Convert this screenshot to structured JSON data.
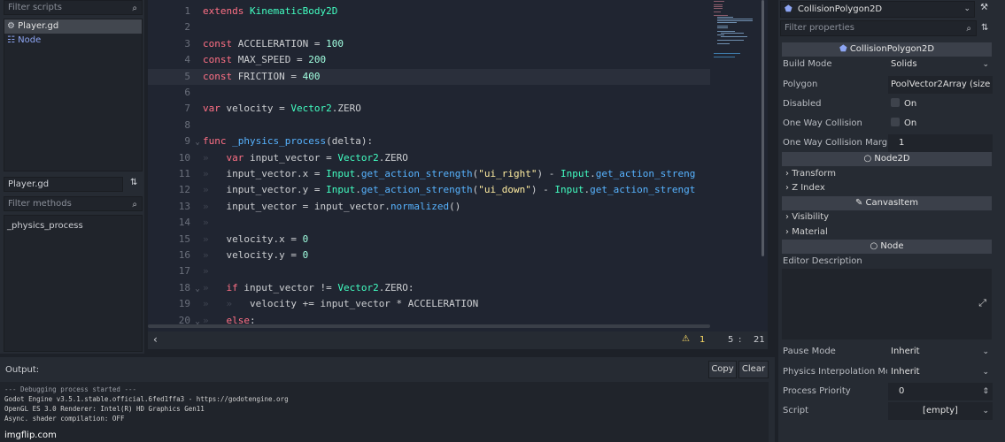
{
  "left_panel": {
    "filter_scripts_placeholder": "Filter scripts",
    "scripts": [
      {
        "label": "Player.gd",
        "icon": "gear-script-icon",
        "selected": true
      },
      {
        "label": "Node",
        "icon": "node-icon",
        "selected": false
      }
    ],
    "current_script": "Player.gd",
    "filter_methods_placeholder": "Filter methods",
    "methods": [
      "_physics_process"
    ]
  },
  "editor": {
    "current_line": 5,
    "lines": [
      {
        "n": "1",
        "html": "<span class='kw'>extends</span> <span class='ty'>KinematicBody2D</span>"
      },
      {
        "n": "2",
        "html": ""
      },
      {
        "n": "3",
        "html": "<span class='kw'>const</span> ACCELERATION = <span class='num'>100</span>"
      },
      {
        "n": "4",
        "html": "<span class='kw'>const</span> MAX_SPEED = <span class='num'>200</span>"
      },
      {
        "n": "5",
        "html": "<span class='kw'>const</span> FRICTION = <span class='num'>400</span>"
      },
      {
        "n": "6",
        "html": ""
      },
      {
        "n": "7",
        "html": "<span class='kw'>var</span> velocity = <span class='ty'>Vector2</span>.ZERO"
      },
      {
        "n": "8",
        "html": ""
      },
      {
        "n": "9",
        "fold": "⌄",
        "html": "<span class='kw'>func</span> <span class='fn'>_physics_process</span>(delta):"
      },
      {
        "n": "10",
        "html": "<span class='tab'>»</span>   <span class='kw'>var</span> input_vector = <span class='ty'>Vector2</span>.ZERO"
      },
      {
        "n": "11",
        "html": "<span class='tab'>»</span>   input_vector.x = <span class='ty'>Input</span>.<span class='fn'>get_action_strength</span>(<span class='str'>\"ui_right\"</span>) - <span class='ty'>Input</span>.<span class='fn'>get_action_streng</span>"
      },
      {
        "n": "12",
        "html": "<span class='tab'>»</span>   input_vector.y = <span class='ty'>Input</span>.<span class='fn'>get_action_strength</span>(<span class='str'>\"ui_down\"</span>) - <span class='ty'>Input</span>.<span class='fn'>get_action_strengt</span>"
      },
      {
        "n": "13",
        "html": "<span class='tab'>»</span>   input_vector = input_vector.<span class='fn'>normalized</span>()"
      },
      {
        "n": "14",
        "html": "<span class='tab'>»</span>"
      },
      {
        "n": "15",
        "html": "<span class='tab'>»</span>   velocity.x = <span class='num'>0</span>"
      },
      {
        "n": "16",
        "html": "<span class='tab'>»</span>   velocity.y = <span class='num'>0</span>"
      },
      {
        "n": "17",
        "html": "<span class='tab'>»</span>"
      },
      {
        "n": "18",
        "fold": "⌄",
        "html": "<span class='tab'>»</span>   <span class='kw'>if</span> input_vector != <span class='ty'>Vector2</span>.ZERO:"
      },
      {
        "n": "19",
        "html": "<span class='tab'>»</span>   <span class='tab'>»</span>   velocity += input_vector * ACCELERATION"
      },
      {
        "n": "20",
        "fold": "⌄",
        "html": "<span class='tab'>»</span>   <span class='kw'>else</span>:"
      }
    ]
  },
  "status": {
    "back": "‹",
    "warning_count": "1",
    "line": "5",
    "sep": ":",
    "col": "21"
  },
  "output": {
    "title": "Output:",
    "copy_label": "Copy",
    "clear_label": "Clear",
    "lines": [
      "--- Debugging process started ---",
      "Godot Engine v3.5.1.stable.official.6fed1ffa3 - https://godotengine.org",
      "OpenGL ES 3.0 Renderer: Intel(R) HD Graphics Gen11",
      "Async. shader compilation: OFF"
    ],
    "watermark": "imgflip.com"
  },
  "inspector": {
    "node_name": "CollisionPolygon2D",
    "filter_placeholder": "Filter properties",
    "class_header": "CollisionPolygon2D",
    "build_mode_label": "Build Mode",
    "build_mode_value": "Solids",
    "polygon_label": "Polygon",
    "polygon_value": "PoolVector2Array (size",
    "disabled_label": "Disabled",
    "disabled_value": "On",
    "one_way_label": "One Way Collision",
    "one_way_value": "On",
    "one_way_margin_label": "One Way Collision Margi",
    "one_way_margin_value": "1",
    "node2d_header": "Node2D",
    "transform_label": "Transform",
    "zindex_label": "Z Index",
    "canvasitem_header": "CanvasItem",
    "visibility_label": "Visibility",
    "material_label": "Material",
    "node_header": "Node",
    "editor_desc_label": "Editor Description",
    "pause_mode_label": "Pause Mode",
    "pause_mode_value": "Inherit",
    "physics_interp_label": "Physics Interpolation Mo",
    "physics_interp_value": "Inherit",
    "process_priority_label": "Process Priority",
    "process_priority_value": "0",
    "script_label": "Script",
    "script_value": "[empty]"
  }
}
